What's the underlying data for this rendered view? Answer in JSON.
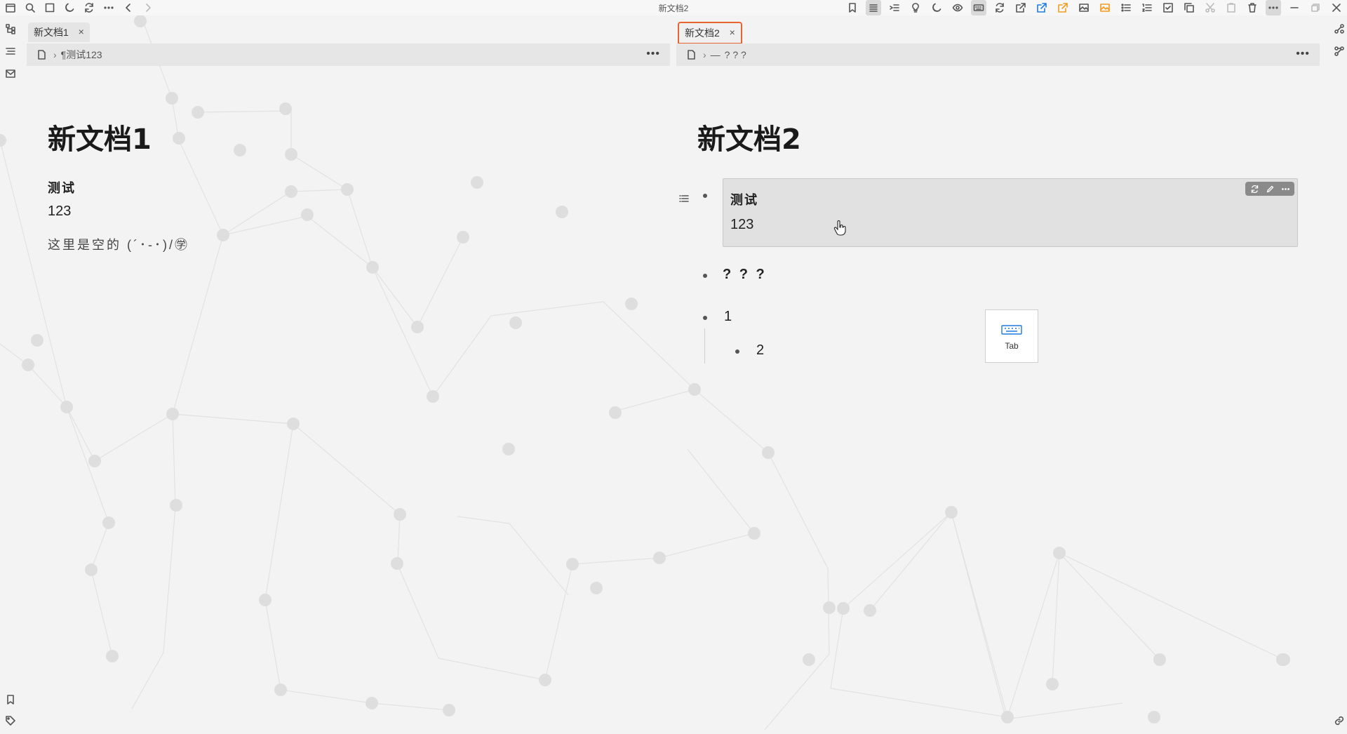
{
  "window": {
    "title": "新文档2"
  },
  "pane1": {
    "tab": {
      "label": "新文档1",
      "close": "×"
    },
    "breadcrumb": {
      "item": "测试123",
      "more": "•••"
    },
    "doc": {
      "title": "新文档1",
      "paragraph_bold": "测试",
      "paragraph_number": "123",
      "paragraph_empty": "这里是空的 (´･-･)/㊫"
    }
  },
  "pane2": {
    "tab": {
      "label": "新文档2",
      "close": "×"
    },
    "breadcrumb": {
      "item": "? ? ?",
      "more": "•••"
    },
    "doc": {
      "title": "新文档2",
      "embed": {
        "line1": "测试",
        "line2": "123"
      },
      "items": [
        {
          "text": "? ? ?",
          "level": 0
        },
        {
          "text": "1",
          "level": 0
        },
        {
          "text": "2",
          "level": 1
        }
      ]
    }
  },
  "key_hint": {
    "label": "Tab"
  },
  "colors": {
    "active_tab_border": "#e8632f",
    "accent_blue": "#1f7ae0",
    "accent_orange": "#f29b1e"
  }
}
